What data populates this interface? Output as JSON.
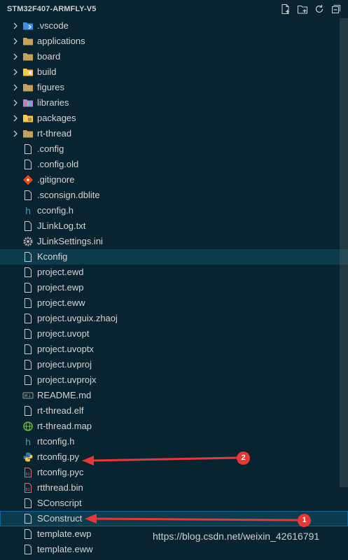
{
  "explorer": {
    "title": "STM32F407-ARMFLY-V5",
    "actions": [
      {
        "name": "new-file-icon"
      },
      {
        "name": "new-folder-icon"
      },
      {
        "name": "refresh-icon"
      },
      {
        "name": "collapse-all-icon"
      }
    ]
  },
  "tree": [
    {
      "label": ".vscode",
      "type": "folder",
      "icon": "vscode-folder-icon",
      "color": "#3b8eea"
    },
    {
      "label": "applications",
      "type": "folder",
      "icon": "folder-icon",
      "color": "#c5a15a"
    },
    {
      "label": "board",
      "type": "folder",
      "icon": "folder-icon",
      "color": "#c5a15a"
    },
    {
      "label": "build",
      "type": "folder",
      "icon": "build-folder-icon",
      "color": "#f2c94c"
    },
    {
      "label": "figures",
      "type": "folder",
      "icon": "folder-icon",
      "color": "#c5a15a"
    },
    {
      "label": "libraries",
      "type": "folder",
      "icon": "libraries-folder-icon",
      "color": "#a88bd6"
    },
    {
      "label": "packages",
      "type": "folder",
      "icon": "packages-folder-icon",
      "color": "#f2c94c"
    },
    {
      "label": "rt-thread",
      "type": "folder",
      "icon": "folder-icon",
      "color": "#c5a15a"
    },
    {
      "label": ".config",
      "type": "file",
      "icon": "file-icon"
    },
    {
      "label": ".config.old",
      "type": "file",
      "icon": "file-icon"
    },
    {
      "label": ".gitignore",
      "type": "file",
      "icon": "git-icon"
    },
    {
      "label": ".sconsign.dblite",
      "type": "file",
      "icon": "file-icon"
    },
    {
      "label": "cconfig.h",
      "type": "file",
      "icon": "header-file-icon"
    },
    {
      "label": "JLinkLog.txt",
      "type": "file",
      "icon": "file-icon"
    },
    {
      "label": "JLinkSettings.ini",
      "type": "file",
      "icon": "gear-icon"
    },
    {
      "label": "Kconfig",
      "type": "file",
      "icon": "file-icon",
      "state": "selected"
    },
    {
      "label": "project.ewd",
      "type": "file",
      "icon": "file-icon"
    },
    {
      "label": "project.ewp",
      "type": "file",
      "icon": "file-icon"
    },
    {
      "label": "project.eww",
      "type": "file",
      "icon": "file-icon"
    },
    {
      "label": "project.uvguix.zhaoj",
      "type": "file",
      "icon": "file-icon"
    },
    {
      "label": "project.uvopt",
      "type": "file",
      "icon": "file-icon"
    },
    {
      "label": "project.uvoptx",
      "type": "file",
      "icon": "file-icon"
    },
    {
      "label": "project.uvproj",
      "type": "file",
      "icon": "file-icon"
    },
    {
      "label": "project.uvprojx",
      "type": "file",
      "icon": "file-icon"
    },
    {
      "label": "README.md",
      "type": "file",
      "icon": "markdown-icon"
    },
    {
      "label": "rt-thread.elf",
      "type": "file",
      "icon": "file-icon"
    },
    {
      "label": "rt-thread.map",
      "type": "file",
      "icon": "globe-icon"
    },
    {
      "label": "rtconfig.h",
      "type": "file",
      "icon": "header-file-icon"
    },
    {
      "label": "rtconfig.py",
      "type": "file",
      "icon": "python-icon"
    },
    {
      "label": "rtconfig.pyc",
      "type": "file",
      "icon": "binary-file-icon"
    },
    {
      "label": "rtthread.bin",
      "type": "file",
      "icon": "binary-file-icon"
    },
    {
      "label": "SConscript",
      "type": "file",
      "icon": "file-icon"
    },
    {
      "label": "SConstruct",
      "type": "file",
      "icon": "file-icon",
      "state": "focused"
    },
    {
      "label": "template.ewp",
      "type": "file",
      "icon": "file-icon"
    },
    {
      "label": "template.eww",
      "type": "file",
      "icon": "file-icon"
    }
  ],
  "annotations": [
    {
      "number": "2"
    },
    {
      "number": "1"
    }
  ],
  "watermark": "https://blog.csdn.net/weixin_42616791",
  "colors": {
    "background": "#072430",
    "selection": "#0c3b4d",
    "callout": "#e53935"
  }
}
